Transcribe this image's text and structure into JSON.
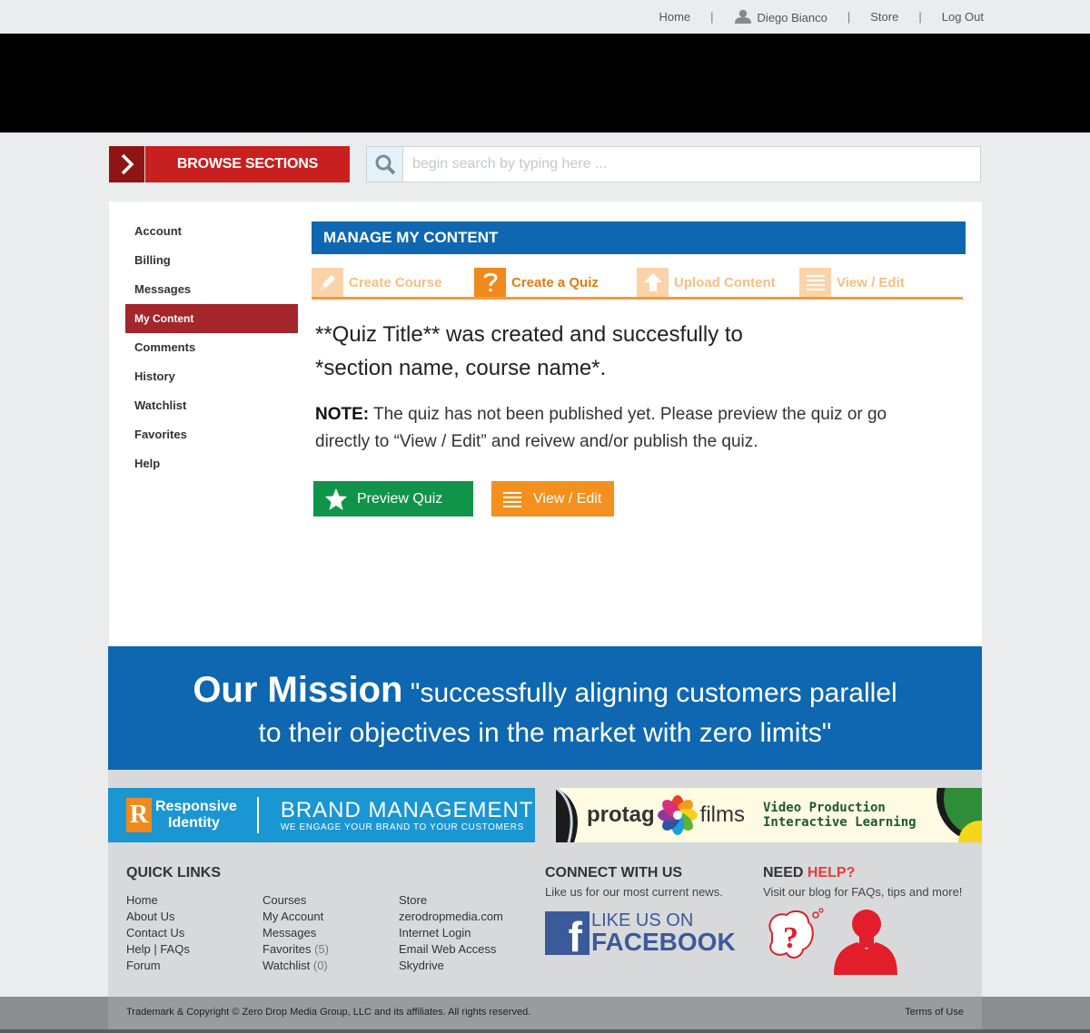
{
  "topnav": {
    "home": "Home",
    "user": "Diego Bianco",
    "store": "Store",
    "logout": "Log Out",
    "separator": "|"
  },
  "browse": {
    "label": "BROWSE SECTIONS"
  },
  "search": {
    "placeholder": "begin search by typing here ..."
  },
  "sidebar": {
    "items": [
      {
        "label": "Account"
      },
      {
        "label": "Billing"
      },
      {
        "label": "Messages"
      },
      {
        "label": "My Content",
        "active": true
      },
      {
        "label": "Comments"
      },
      {
        "label": "History"
      },
      {
        "label": "Watchlist"
      },
      {
        "label": "Favorites"
      },
      {
        "label": "Help"
      }
    ]
  },
  "main": {
    "header": "MANAGE MY CONTENT",
    "tabs": [
      {
        "label": "Create Course",
        "icon": "pencil-icon"
      },
      {
        "label": "Create a Quiz",
        "icon": "question-icon",
        "active": true
      },
      {
        "label": "Upload Content",
        "icon": "upload-arrow-icon"
      },
      {
        "label": "View / Edit",
        "icon": "list-icon"
      }
    ],
    "message_line1": "**Quiz Title**  was created and succesfully to",
    "message_line2": "*section name, course name*.",
    "note_label": "NOTE:",
    "note_text": " The quiz has not been published yet. Please preview the quiz or go directly to “View / Edit” and reivew and/or publish the quiz.",
    "preview_button": "Preview Quiz",
    "view_edit_button": "View / Edit"
  },
  "mission": {
    "title": "Our Mission",
    "line1": " \"successfully aligning customers parallel",
    "line2": "to their objectives in the market with zero limits\""
  },
  "ads": {
    "responsive_1": "Responsive",
    "responsive_2": "Identity",
    "responsive_letter": "R",
    "brand_title": "BRAND MANAGEMENT",
    "brand_tagline": "WE ENGAGE YOUR BRAND TO YOUR CUSTOMERS",
    "protag": "protag",
    "films": "films",
    "vp_line1": "Video Production",
    "vp_line2": "Interactive Learning"
  },
  "footer": {
    "quicklinks_title": "QUICK LINKS",
    "col1": [
      "Home",
      "About Us",
      "Contact Us",
      "Help | FAQs",
      "Forum"
    ],
    "col2": [
      {
        "label": "Courses"
      },
      {
        "label": "My Account"
      },
      {
        "label": "Messages"
      },
      {
        "label": "Favorites",
        "count": "(5)"
      },
      {
        "label": "Watchlist",
        "count": "(0)"
      }
    ],
    "col3": [
      "Store",
      "zerodropmedia.com",
      "Internet Login",
      "Email Web Access",
      "Skydrive"
    ],
    "connect_title": "CONNECT WITH US",
    "connect_sub": "Like us for our most current news.",
    "fb_like": "LIKE US ON",
    "fb_name": "FACEBOOK",
    "fb_letter": "f",
    "help_title": "NEED ",
    "help_title_red": "HELP?",
    "help_sub": "Visit our blog for FAQs, tips and more!",
    "copyright": "Trademark & Copyright © Zero Drop Media Group, LLC and its affiliates. All rights reserved.",
    "terms": "Terms of Use"
  },
  "colors": {
    "brand_blue": "#0e67b0",
    "browse_red": "#c8201f",
    "active_nav": "#a4252a",
    "accent_orange": "#f08a1c",
    "green": "#109449"
  }
}
